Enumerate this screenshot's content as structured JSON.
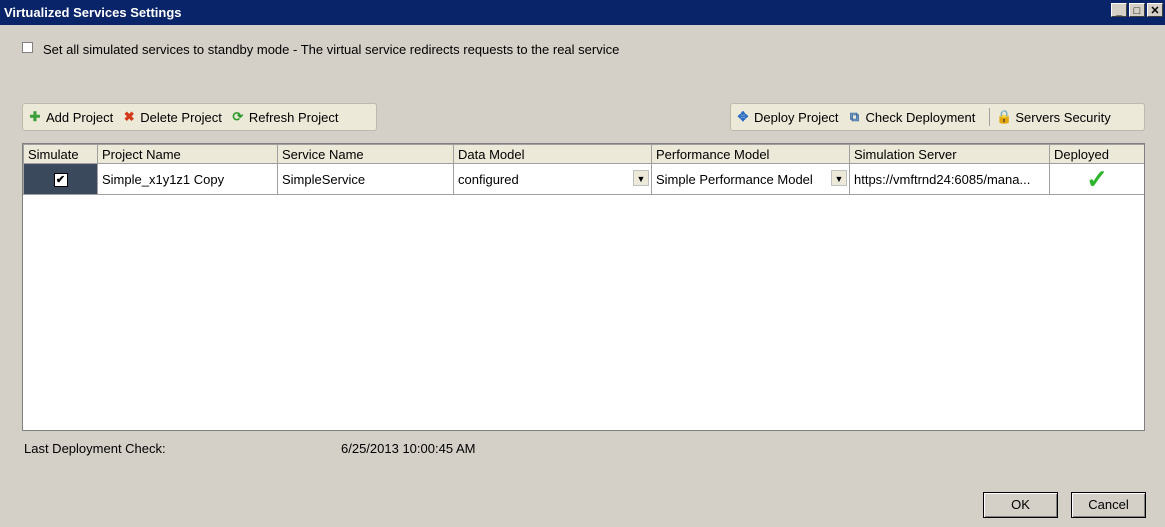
{
  "window": {
    "title": "Virtualized Services Settings",
    "minimize": "_",
    "maximize": "□",
    "close": "✕"
  },
  "standby": {
    "label": "Set all simulated services to standby mode  - The virtual service redirects requests to the real service",
    "checked": false
  },
  "toolbar_left": {
    "add": "Add Project",
    "delete": "Delete Project",
    "refresh": "Refresh Project"
  },
  "toolbar_right": {
    "deploy": "Deploy Project",
    "check": "Check Deployment",
    "security": "Servers Security"
  },
  "grid": {
    "headers": [
      "Simulate",
      "Project Name",
      "Service Name",
      "Data Model",
      "Performance Model",
      "Simulation Server",
      "Deployed"
    ],
    "rows": [
      {
        "simulate": true,
        "project_name": "Simple_x1y1z1 Copy",
        "service_name": "SimpleService",
        "data_model": "configured",
        "performance_model": "Simple Performance Model",
        "simulation_server": "https://vmftrnd24:6085/mana...",
        "deployed": "✓"
      }
    ]
  },
  "footer": {
    "last_check_label": "Last Deployment Check:",
    "last_check_value": "6/25/2013 10:00:45 AM",
    "ok": "OK",
    "cancel": "Cancel"
  },
  "colors": {
    "titlebar": "#0a246a",
    "deployed_check": "#2db52d",
    "selected_sim_cell": "#3a4a5c"
  }
}
